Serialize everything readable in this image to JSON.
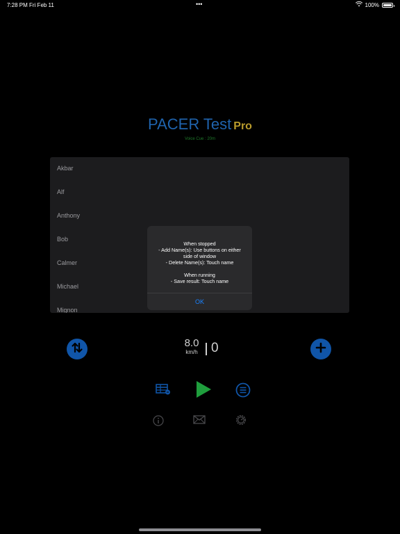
{
  "status_bar": {
    "time": "7:28 PM",
    "date": "Fri Feb 11",
    "multitask_dots": "•••",
    "battery": "100%"
  },
  "header": {
    "title": "PACER Test",
    "badge": "Pro",
    "voice_cue": "Voice Cue : 20m"
  },
  "names": [
    "Akbar",
    "Alf",
    "Anthony",
    "Bob",
    "Calmer",
    "Michael",
    "Mignon"
  ],
  "alert": {
    "message": "When stopped\n- Add Name(s): Use buttons on either\nside of window\n- Delete Name(s): Touch name\n\nWhen running\n- Save result: Touch name",
    "ok_label": "OK"
  },
  "speed": {
    "value": "8.0",
    "unit": "km/h",
    "count": "0"
  },
  "colors": {
    "accent_blue": "#1055a8",
    "play_green": "#1f9e3d",
    "title_blue": "#1f63ad",
    "pro_gold": "#b89b2c"
  },
  "icons": [
    "sort-arrows-icon",
    "add-icon",
    "table-icon",
    "play-icon",
    "list-icon",
    "info-icon",
    "mail-icon",
    "settings-icon"
  ]
}
